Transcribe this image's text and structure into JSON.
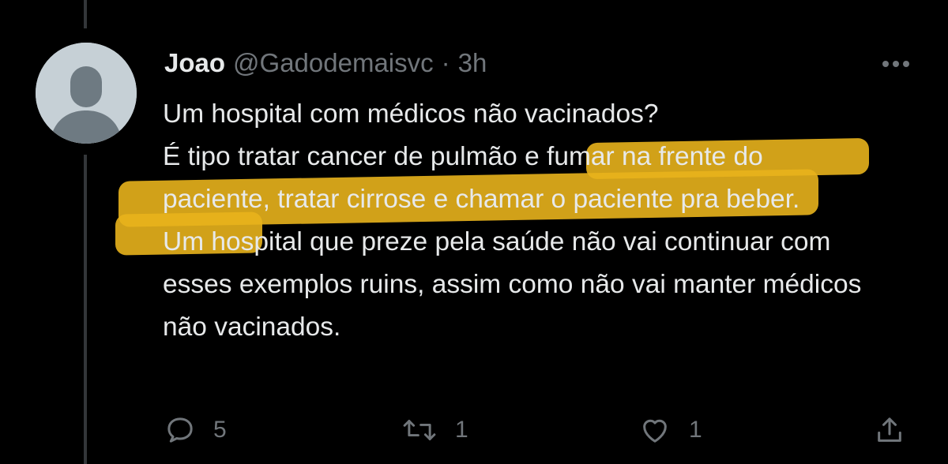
{
  "tweet": {
    "author_name": "Joao",
    "handle": "@Gadodemaisvc",
    "separator": "·",
    "time": "3h",
    "lines": [
      "Um hospital com médicos não vacinados?",
      "É tipo tratar cancer de pulmão e fumar na frente do paciente, tratar cirrose e chamar o paciente pra beber.",
      "Um hospital que preze pela saúde não vai continuar com esses exemplos ruins, assim como não vai manter médicos não vacinados."
    ]
  },
  "actions": {
    "reply_count": "5",
    "retweet_count": "1",
    "like_count": "1"
  },
  "colors": {
    "background": "#000000",
    "text_primary": "#e7e9ea",
    "text_secondary": "#71767b",
    "highlight": "#e8b31c",
    "avatar_bg": "#c6d0d6",
    "avatar_fg": "#6e7a82"
  },
  "icons": {
    "more": "more-horizontal-icon",
    "reply": "reply-bubble-icon",
    "retweet": "retweet-icon",
    "like": "heart-icon",
    "share": "share-icon"
  }
}
